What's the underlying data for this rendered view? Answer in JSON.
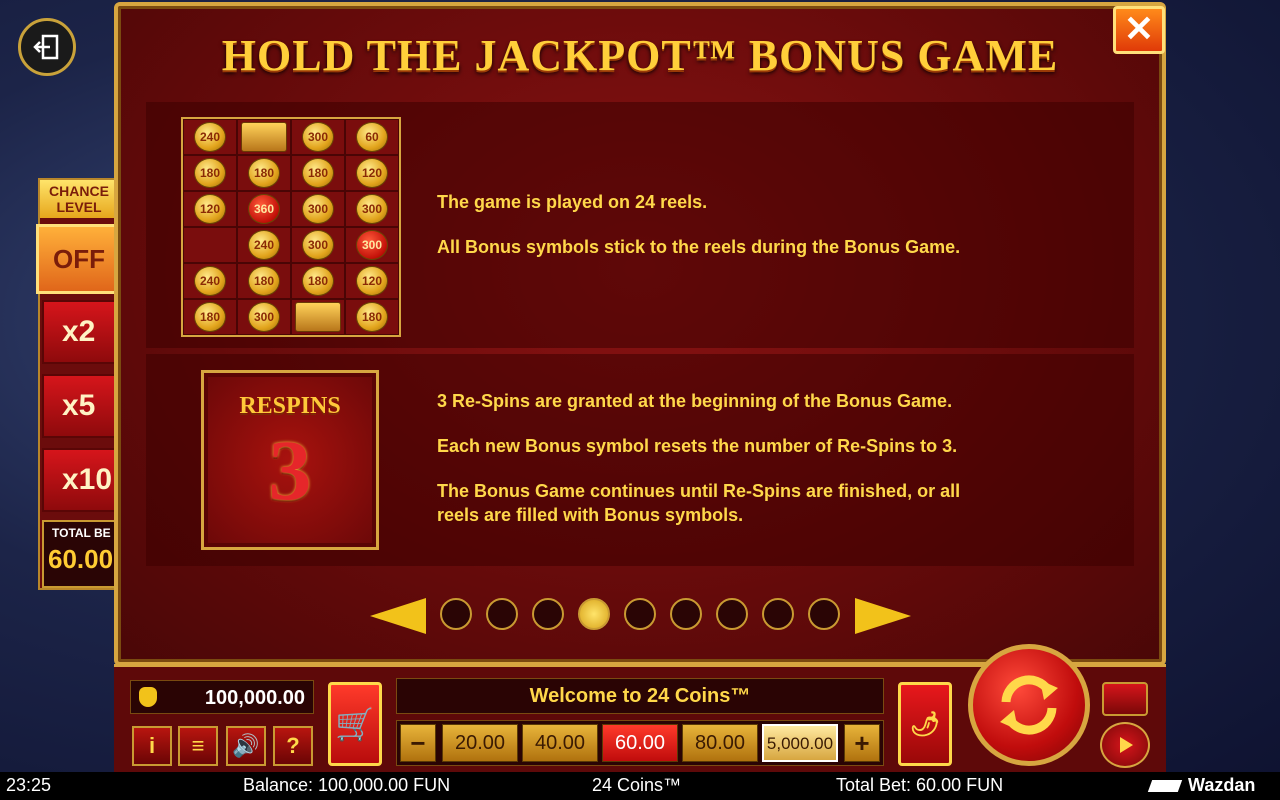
{
  "dialog": {
    "title": "HOLD THE JACKPOT™ BONUS GAME",
    "close_label": "✕"
  },
  "section1": {
    "grid_values": [
      [
        "240",
        "chest",
        "300",
        "60"
      ],
      [
        "180",
        "180",
        "180",
        "120"
      ],
      [
        "120",
        "360",
        "300",
        "300"
      ],
      [
        "",
        "240",
        "300",
        "300"
      ],
      [
        "240",
        "180",
        "180",
        "120"
      ],
      [
        "180",
        "300",
        "chest",
        "180"
      ]
    ],
    "red_coins": [
      "360",
      "300"
    ],
    "line1": "The game is played on 24 reels.",
    "line2": "All Bonus symbols stick to the reels during the Bonus Game."
  },
  "section2": {
    "respins_label": "RESPINS",
    "respins_number": "3",
    "line1": "3 Re-Spins are granted at the beginning of the Bonus Game.",
    "line2": "Each new Bonus symbol resets the number of Re-Spins to 3.",
    "line3a": "The Bonus Game continues until Re-Spins are finished, or all",
    "line3b": "reels are filled with Bonus symbols."
  },
  "pagination": {
    "total": 9,
    "active_index": 3
  },
  "side_panel": {
    "chance_line1": "CHANCE",
    "chance_line2": "LEVEL",
    "off_label": "OFF",
    "x2_label": "x2",
    "x5_label": "x5",
    "x10_label": "x10",
    "total_bet_label": "TOTAL BE",
    "total_bet_value": "60.00"
  },
  "controls": {
    "balance_value": "100,000.00",
    "welcome_text": "Welcome to 24 Coins™",
    "minus_label": "−",
    "plus_label": "+",
    "bets": [
      "20.00",
      "40.00",
      "60.00",
      "80.00",
      "5,000.00"
    ],
    "active_bet": "60.00",
    "info_label": "i",
    "menu_label": "≡",
    "sound_label": "🔊",
    "help_label": "?",
    "cart_label": "🛒",
    "chili_label": "🌶🌶"
  },
  "status": {
    "time": "23:25",
    "balance": "Balance: 100,000.00 FUN",
    "game_name": "24 Coins™",
    "total_bet": "Total Bet: 60.00 FUN",
    "brand": "Wazdan"
  },
  "colors": {
    "gold": "#ffd84a",
    "dialog_red": "#8a1212",
    "active_bet": "#e0181c"
  }
}
